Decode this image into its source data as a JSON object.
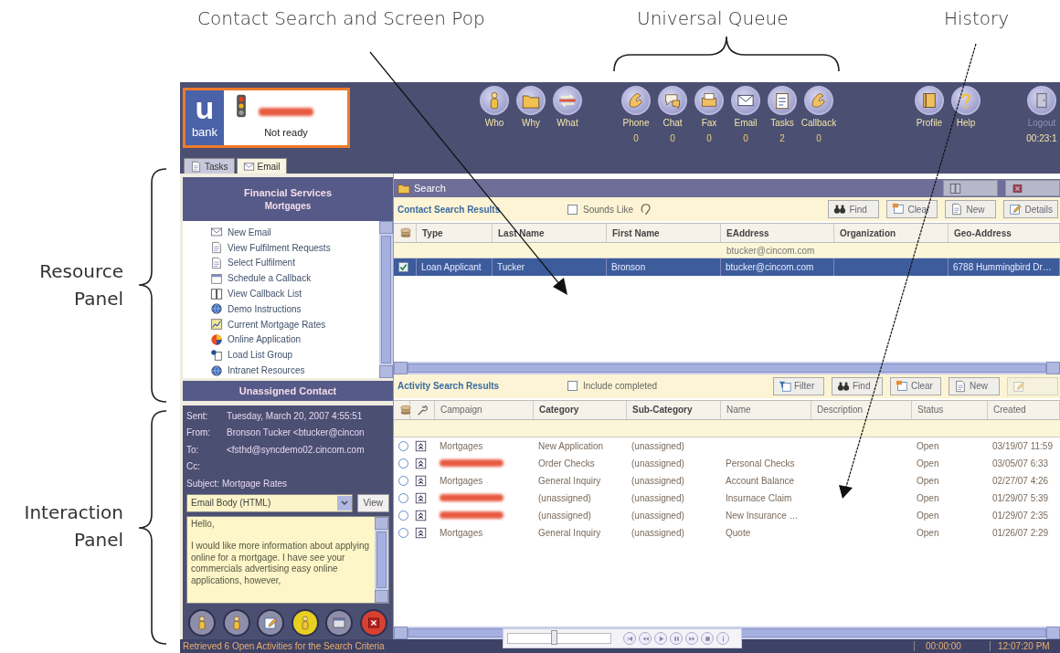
{
  "callouts": [
    {
      "text": "Contact Search and Screen Pop"
    },
    {
      "text": "Universal Queue"
    },
    {
      "text": "History"
    }
  ],
  "panel_labels": [
    {
      "text": "Resource Panel"
    },
    {
      "text": "Interaction Panel"
    }
  ],
  "header": {
    "logo": {
      "letter": "u",
      "word": "bank"
    },
    "status_name_redacted": true,
    "agent_status": "Not ready",
    "tools": [
      {
        "label": "Who"
      },
      {
        "label": "Why"
      },
      {
        "label": "What"
      }
    ],
    "queue": [
      {
        "label": "Phone",
        "count": "0"
      },
      {
        "label": "Chat",
        "count": "0"
      },
      {
        "label": "Fax",
        "count": "0"
      },
      {
        "label": "Email",
        "count": "0"
      },
      {
        "label": "Tasks",
        "count": "2"
      },
      {
        "label": "Callback",
        "count": "0"
      }
    ],
    "utilities": [
      {
        "label": "Profile",
        "disabled": false
      },
      {
        "label": "Help",
        "disabled": false
      },
      {
        "label": "Logout",
        "disabled": true
      }
    ],
    "session_time": "00:23:1"
  },
  "tabs": [
    {
      "label": "Tasks",
      "selected": false
    },
    {
      "label": "Email",
      "selected": true
    }
  ],
  "resource_panel": {
    "title": "Financial Services",
    "subtitle": "Mortgages",
    "items": [
      {
        "label": "New Email"
      },
      {
        "label": "View Fulfilment Requests"
      },
      {
        "label": "Select Fulfilment"
      },
      {
        "label": "Schedule a Callback"
      },
      {
        "label": "View Callback List"
      },
      {
        "label": "Demo Instructions"
      },
      {
        "label": "Current Mortgage Rates"
      },
      {
        "label": "Online Application"
      },
      {
        "label": "Load List Group"
      },
      {
        "label": "Intranet Resources"
      }
    ],
    "footer": "Unassigned Contact"
  },
  "email": {
    "fields": [
      {
        "label": "Sent:",
        "value": "Tuesday, March 20, 2007 4:55:51"
      },
      {
        "label": "From:",
        "value": "Bronson Tucker <btucker@cincon"
      },
      {
        "label": "To:",
        "value": "<fsthd@syncdemo02.cincom.com"
      },
      {
        "label": "Cc:"
      }
    ],
    "subject": "Subject: Mortgage Rates",
    "body_format": "Email Body (HTML)",
    "view_button": "View",
    "body": [
      "Hello,",
      "I would like more information about applying online for a mortgage.  I have see your commercials advertising easy online applications, however,"
    ],
    "actions": [
      {
        "color": "#8e8ea8"
      },
      {
        "color": "#8e8ea8"
      },
      {
        "color": "#8e8ea8"
      },
      {
        "color": "#e8d020"
      },
      {
        "color": "#8e8ea8"
      },
      {
        "color": "#d84030"
      }
    ]
  },
  "contact_search": {
    "title": "Search",
    "title_buttons": [
      {
        "disabled": true
      },
      {
        "disabled": true
      }
    ],
    "results_label": "Contact Search Results",
    "sounds_like": {
      "label": "Sounds Like",
      "checked": false
    },
    "buttons": [
      {
        "label": "Find"
      },
      {
        "label": "Clear"
      },
      {
        "label": "New"
      },
      {
        "label": "Details"
      }
    ],
    "columns": [
      {
        "label": "Type"
      },
      {
        "label": "Last Name"
      },
      {
        "label": "First Name"
      },
      {
        "label": "EAddress",
        "filter": "btucker@cincom.com"
      },
      {
        "label": "Organization"
      },
      {
        "label": "Geo-Address"
      }
    ],
    "rows": [
      {
        "selected": true,
        "checked": true,
        "type": "Loan Applicant",
        "last_name": "Tucker",
        "first_name": "Bronson",
        "eaddress": "btucker@cincom.com",
        "geo_address": "6788 Hummingbird Dr…"
      }
    ]
  },
  "activity_search": {
    "results_label": "Activity Search Results",
    "include_completed": {
      "label": "Include completed",
      "checked": false
    },
    "buttons": [
      {
        "label": "Filter",
        "disabled": false
      },
      {
        "label": "Find",
        "disabled": false
      },
      {
        "label": "Clear",
        "disabled": false
      },
      {
        "label": "New",
        "disabled": false
      },
      {
        "disabled": true
      }
    ],
    "columns": [
      {
        "label": "Campaign"
      },
      {
        "label": "Category"
      },
      {
        "label": "Sub-Category"
      },
      {
        "label": "Name"
      },
      {
        "label": "Description"
      },
      {
        "label": "Status"
      },
      {
        "label": "Created"
      }
    ],
    "rows": [
      {
        "selected": false,
        "campaign": "Mortgages",
        "category": "New Application",
        "sub_category": "(unassigned)",
        "status": "Open",
        "created": "03/19/07 11:59"
      },
      {
        "selected": false,
        "campaign_redacted": true,
        "category": "Order Checks",
        "sub_category": "(unassigned)",
        "name": "Personal Checks",
        "status": "Open",
        "created": "03/05/07 6:33"
      },
      {
        "selected": false,
        "campaign": "Mortgages",
        "category": "General Inquiry",
        "sub_category": "(unassigned)",
        "name": "Account Balance",
        "status": "Open",
        "created": "02/27/07 4:26"
      },
      {
        "selected": false,
        "campaign_redacted": true,
        "category": "(unassigned)",
        "sub_category": "(unassigned)",
        "name": "Insurnace Claim",
        "status": "Open",
        "created": "01/29/07 5:39"
      },
      {
        "selected": false,
        "campaign_redacted": true,
        "category": "(unassigned)",
        "sub_category": "(unassigned)",
        "name": "New Insurance …",
        "status": "Open",
        "created": "01/29/07 2:35"
      },
      {
        "selected": false,
        "campaign": "Mortgages",
        "category": "General Inquiry",
        "sub_category": "(unassigned)",
        "name": "Quote",
        "status": "Open",
        "created": "01/26/07 2:29"
      }
    ]
  },
  "media_player": {
    "level": 0.45
  },
  "status_bar": {
    "message": "Retrieved 6 Open Activities for the Search Criteria",
    "elapsed": "00:00:00",
    "clock": "12:07:20 PM"
  }
}
